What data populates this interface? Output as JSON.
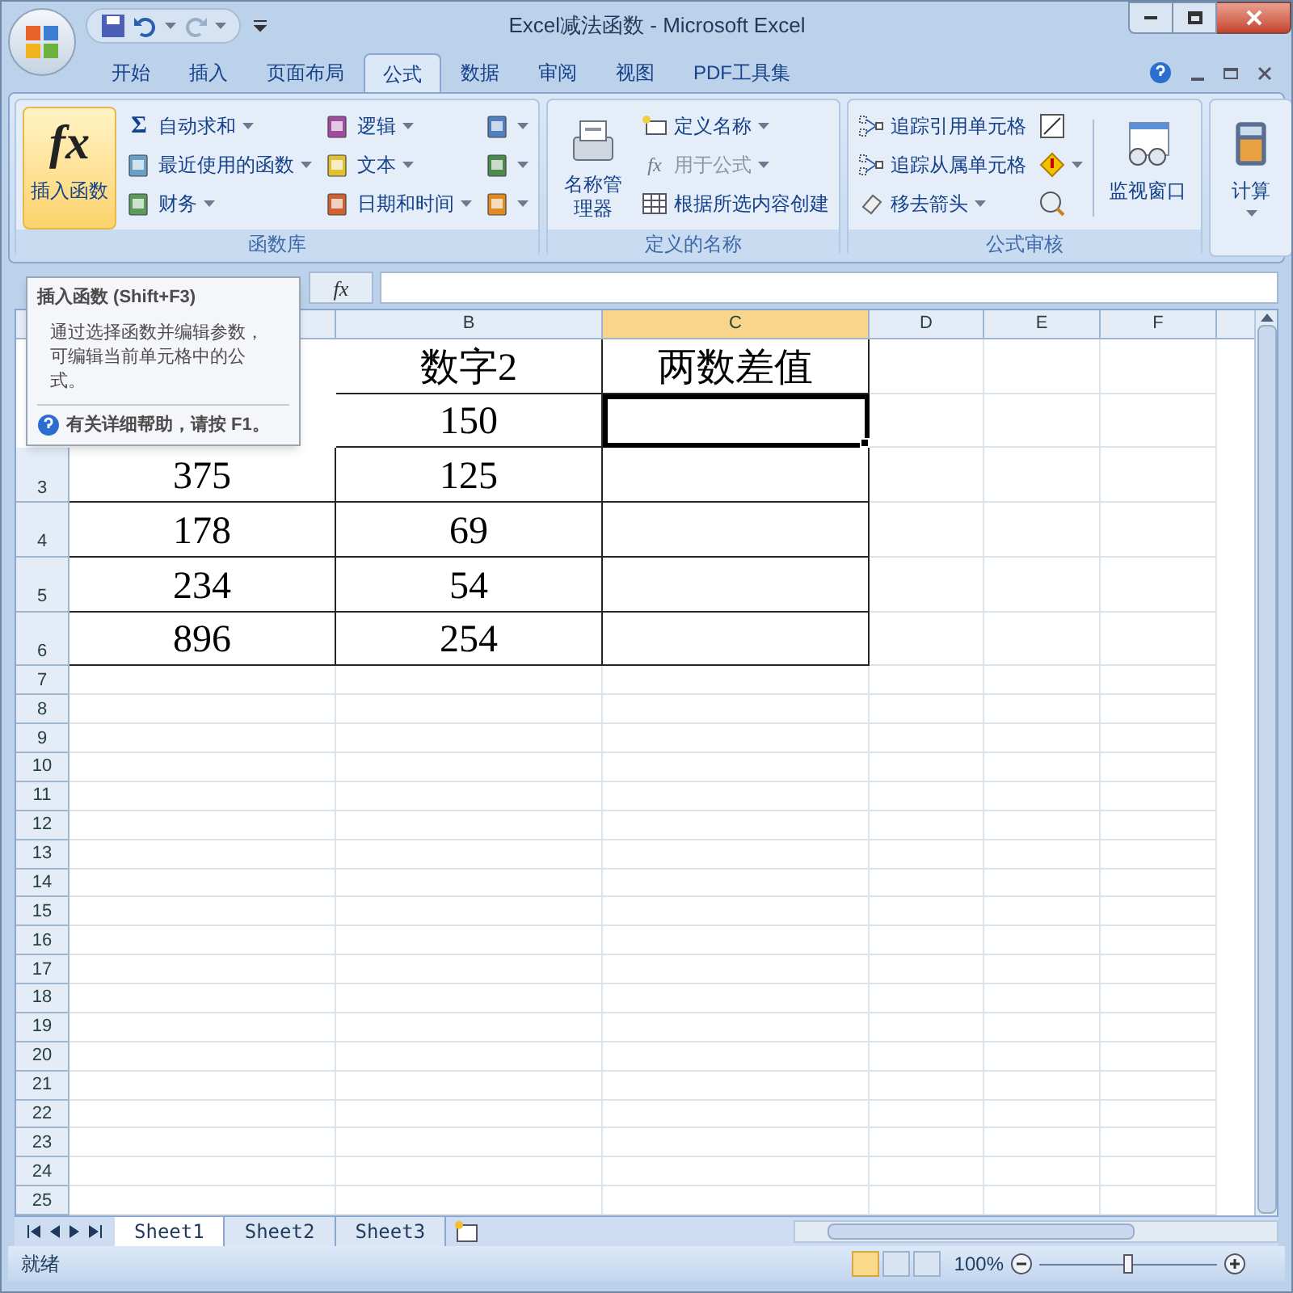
{
  "window": {
    "title": "Excel减法函数 - Microsoft Excel"
  },
  "tabs": [
    {
      "label": "开始",
      "selected": false
    },
    {
      "label": "插入",
      "selected": false
    },
    {
      "label": "页面布局",
      "selected": false
    },
    {
      "label": "公式",
      "selected": true
    },
    {
      "label": "数据",
      "selected": false
    },
    {
      "label": "审阅",
      "selected": false
    },
    {
      "label": "视图",
      "selected": false
    },
    {
      "label": "PDF工具集",
      "selected": false
    }
  ],
  "ribbon_groups": [
    {
      "label": "函数库",
      "columns": [
        {
          "kind": "large",
          "items": [
            {
              "label": "插入函数",
              "symbol": "fx",
              "highlighted": true
            }
          ]
        },
        {
          "kind": "stack",
          "items": [
            {
              "label": "自动求和",
              "symbol": "Σ",
              "dropdown": true
            },
            {
              "label": "最近使用的函数",
              "dropdown": true
            },
            {
              "label": "财务",
              "dropdown": true
            }
          ]
        },
        {
          "kind": "stack",
          "items": [
            {
              "label": "逻辑",
              "dropdown": true
            },
            {
              "label": "文本",
              "dropdown": true
            },
            {
              "label": "日期和时间",
              "dropdown": true
            }
          ]
        },
        {
          "kind": "stack",
          "items": [
            {
              "dropdown": true
            },
            {
              "dropdown": true
            },
            {
              "dropdown": true
            }
          ]
        }
      ]
    },
    {
      "label": "定义的名称",
      "columns": [
        {
          "kind": "large",
          "items": [
            {
              "label": "名称管理器",
              "highlighted": false
            }
          ]
        },
        {
          "kind": "stack",
          "items": [
            {
              "label": "定义名称",
              "dropdown": true
            },
            {
              "label": "用于公式",
              "symbol": "fx",
              "dropdown": true,
              "disabled": true
            },
            {
              "label": "根据所选内容创建"
            }
          ]
        }
      ]
    },
    {
      "label": "公式审核",
      "columns": [
        {
          "kind": "stack",
          "items": [
            {
              "label": "追踪引用单元格"
            },
            {
              "label": "追踪从属单元格"
            },
            {
              "label": "移去箭头",
              "dropdown": true
            }
          ]
        },
        {
          "kind": "stack",
          "items": [
            {
              "dropdown": false
            },
            {
              "dropdown": true
            },
            {
              "dropdown": false
            }
          ]
        },
        {
          "kind": "separator"
        },
        {
          "kind": "large",
          "items": [
            {
              "label": "监视窗口",
              "highlighted": false
            }
          ]
        }
      ]
    },
    {
      "columns": [
        {
          "kind": "large",
          "items": [
            {
              "label": "计算",
              "dropdown": true,
              "highlighted": false
            }
          ]
        }
      ]
    }
  ],
  "formula_bar": {
    "symbol": "fx"
  },
  "tooltip": {
    "title": "插入函数 (Shift+F3)",
    "body": "通过选择函数并编辑参数，可编辑当前单元格中的公式。",
    "help": "有关详细帮助，请按 F1。"
  },
  "sheet": {
    "columns": [
      {
        "selected": false
      },
      {
        "label": "B",
        "selected": false
      },
      {
        "label": "C",
        "selected": true
      },
      {
        "label": "D",
        "selected": false
      },
      {
        "label": "E",
        "selected": false
      },
      {
        "label": "F",
        "selected": false
      }
    ],
    "rows": [
      {
        "kind": "data",
        "selected": false,
        "cells": {
          "1": "数字2",
          "2": "两数差值"
        }
      },
      {
        "kind": "data",
        "selected": true,
        "cells": {
          "1": "150"
        }
      },
      {
        "kind": "data",
        "header": "3",
        "selected": false,
        "cells": {
          "0": "375",
          "1": "125"
        }
      },
      {
        "kind": "data",
        "header": "4",
        "selected": false,
        "cells": {
          "0": "178",
          "1": "69"
        }
      },
      {
        "kind": "data",
        "header": "5",
        "selected": false,
        "cells": {
          "0": "234",
          "1": "54"
        }
      },
      {
        "kind": "data",
        "header": "6",
        "selected": false,
        "cells": {
          "0": "896",
          "1": "254"
        }
      },
      {
        "kind": "empty",
        "header": "7",
        "selected": false
      },
      {
        "kind": "empty",
        "header": "8",
        "selected": false
      },
      {
        "kind": "empty",
        "header": "9",
        "selected": false
      },
      {
        "kind": "empty",
        "header": "10",
        "selected": false
      },
      {
        "kind": "empty",
        "header": "11",
        "selected": false
      },
      {
        "kind": "empty",
        "header": "12",
        "selected": false
      },
      {
        "kind": "empty",
        "header": "13",
        "selected": false
      },
      {
        "kind": "empty",
        "header": "14",
        "selected": false
      },
      {
        "kind": "empty",
        "header": "15",
        "selected": false
      },
      {
        "kind": "empty",
        "header": "16",
        "selected": false
      },
      {
        "kind": "empty",
        "header": "17",
        "selected": false
      },
      {
        "kind": "empty",
        "header": "18",
        "selected": false
      },
      {
        "kind": "empty",
        "header": "19",
        "selected": false
      },
      {
        "kind": "empty",
        "header": "20",
        "selected": false
      },
      {
        "kind": "empty",
        "header": "21",
        "selected": false
      },
      {
        "kind": "empty",
        "header": "22",
        "selected": false
      },
      {
        "kind": "empty",
        "header": "23",
        "selected": false
      },
      {
        "kind": "empty",
        "header": "24",
        "selected": false
      },
      {
        "kind": "empty",
        "header": "25",
        "selected": false
      }
    ]
  },
  "sheet_tabs": [
    {
      "label": "Sheet1",
      "selected": true
    },
    {
      "label": "Sheet2",
      "selected": false
    },
    {
      "label": "Sheet3",
      "selected": false
    }
  ],
  "status_bar": {
    "status": "就绪",
    "views": [
      {
        "selected": true
      },
      {
        "selected": false
      },
      {
        "selected": false
      }
    ],
    "zoom": "100%",
    "zoom_slider": {
      "level": 0.5
    }
  }
}
